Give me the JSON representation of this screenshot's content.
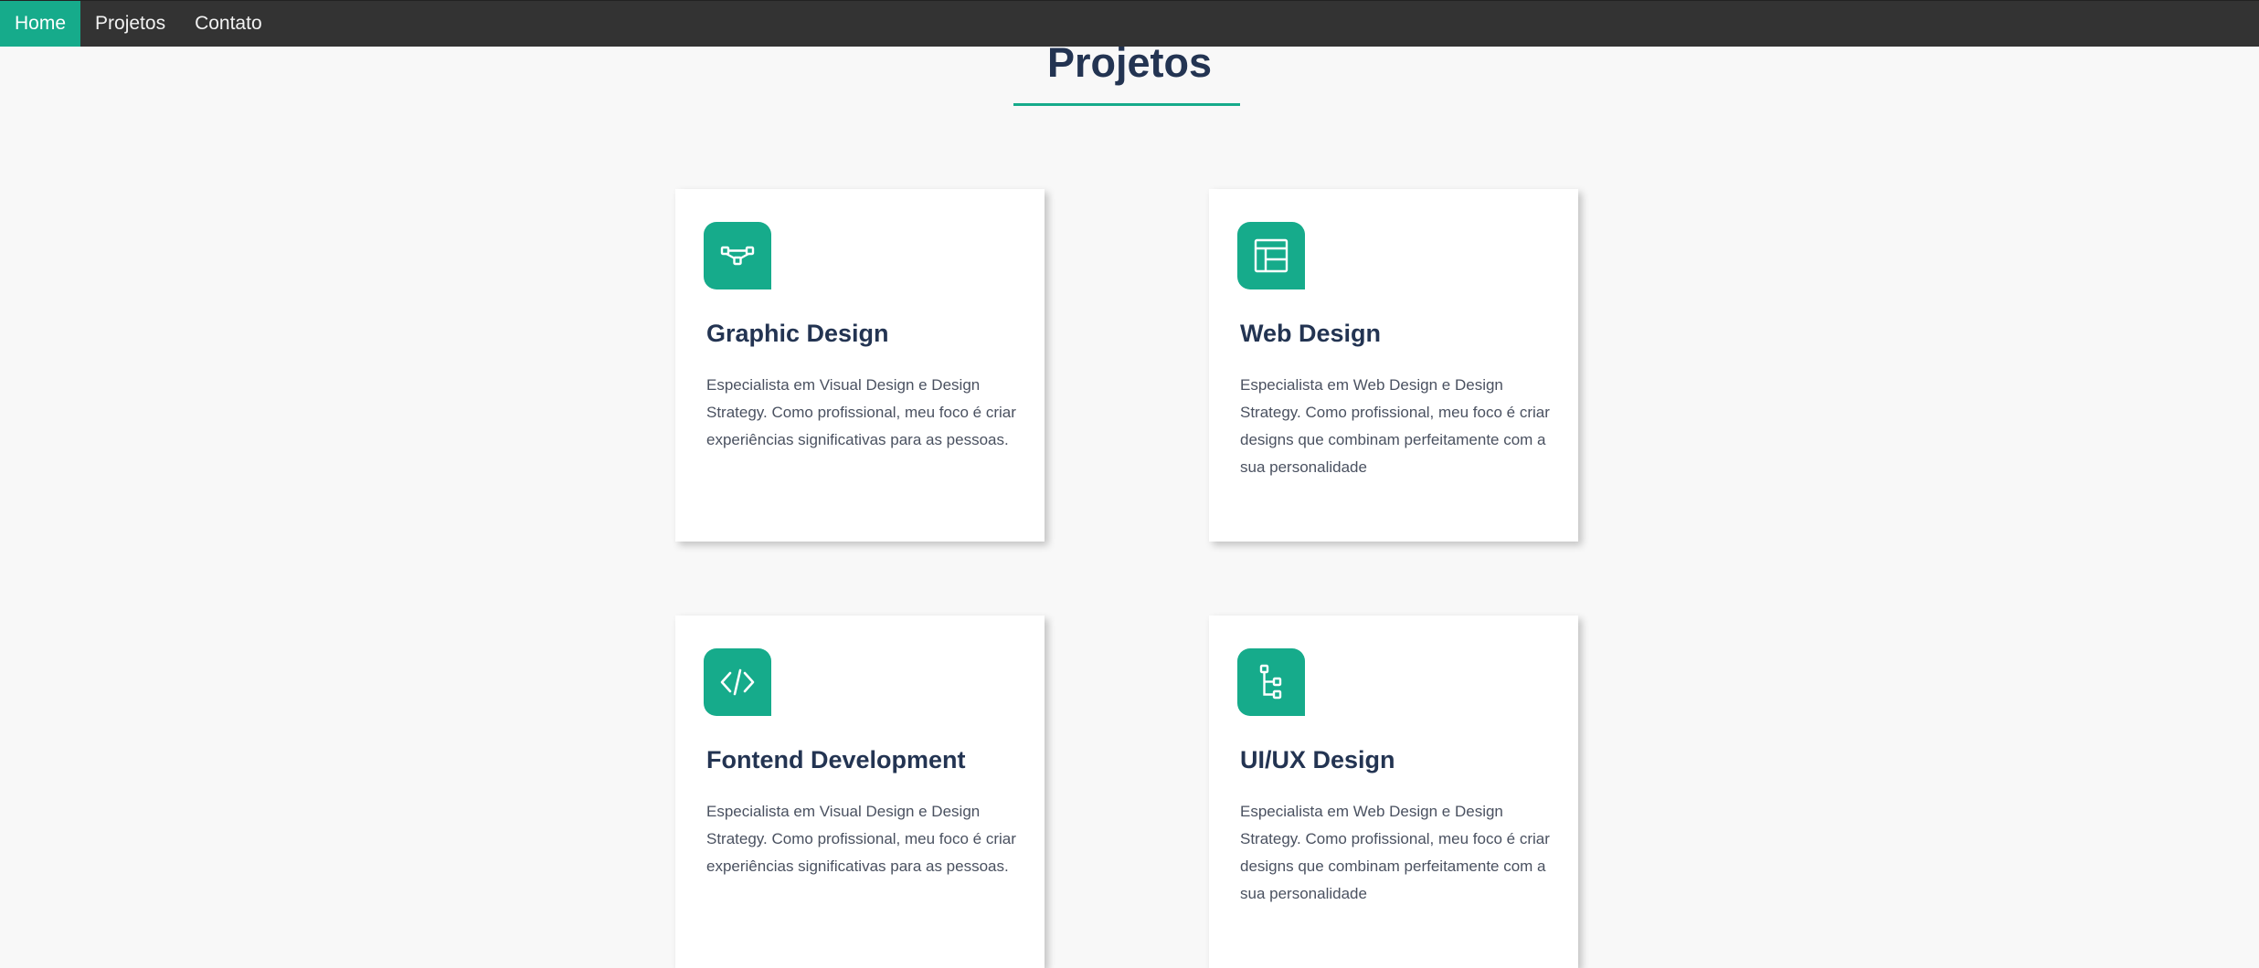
{
  "nav": {
    "items": [
      {
        "label": "Home",
        "active": true
      },
      {
        "label": "Projetos",
        "active": false
      },
      {
        "label": "Contato",
        "active": false
      }
    ]
  },
  "section": {
    "title": "Projetos"
  },
  "colors": {
    "accent": "#16ab8b",
    "navbar": "#333333",
    "heading": "#233452",
    "background": "#f8f8f8"
  },
  "cards": [
    {
      "icon": "vector-path-icon",
      "title": "Graphic Design",
      "text": "Especialista em Visual Design e Design Strategy. Como profissional, meu foco é criar experiências significativas para as pessoas."
    },
    {
      "icon": "layout-icon",
      "title": "Web Design",
      "text": "Especialista em Web Design e Design Strategy. Como profissional, meu foco é criar designs que combinam perfeitamente com a sua personalidade"
    },
    {
      "icon": "code-icon",
      "title": "Fontend Development",
      "text": "Especialista em Visual Design e Design Strategy. Como profissional, meu foco é criar experiências significativas para as pessoas."
    },
    {
      "icon": "sitemap-icon",
      "title": "UI/UX Design",
      "text": "Especialista em Web Design e Design Strategy. Como profissional, meu foco é criar designs que combinam perfeitamente com a sua personalidade"
    }
  ]
}
